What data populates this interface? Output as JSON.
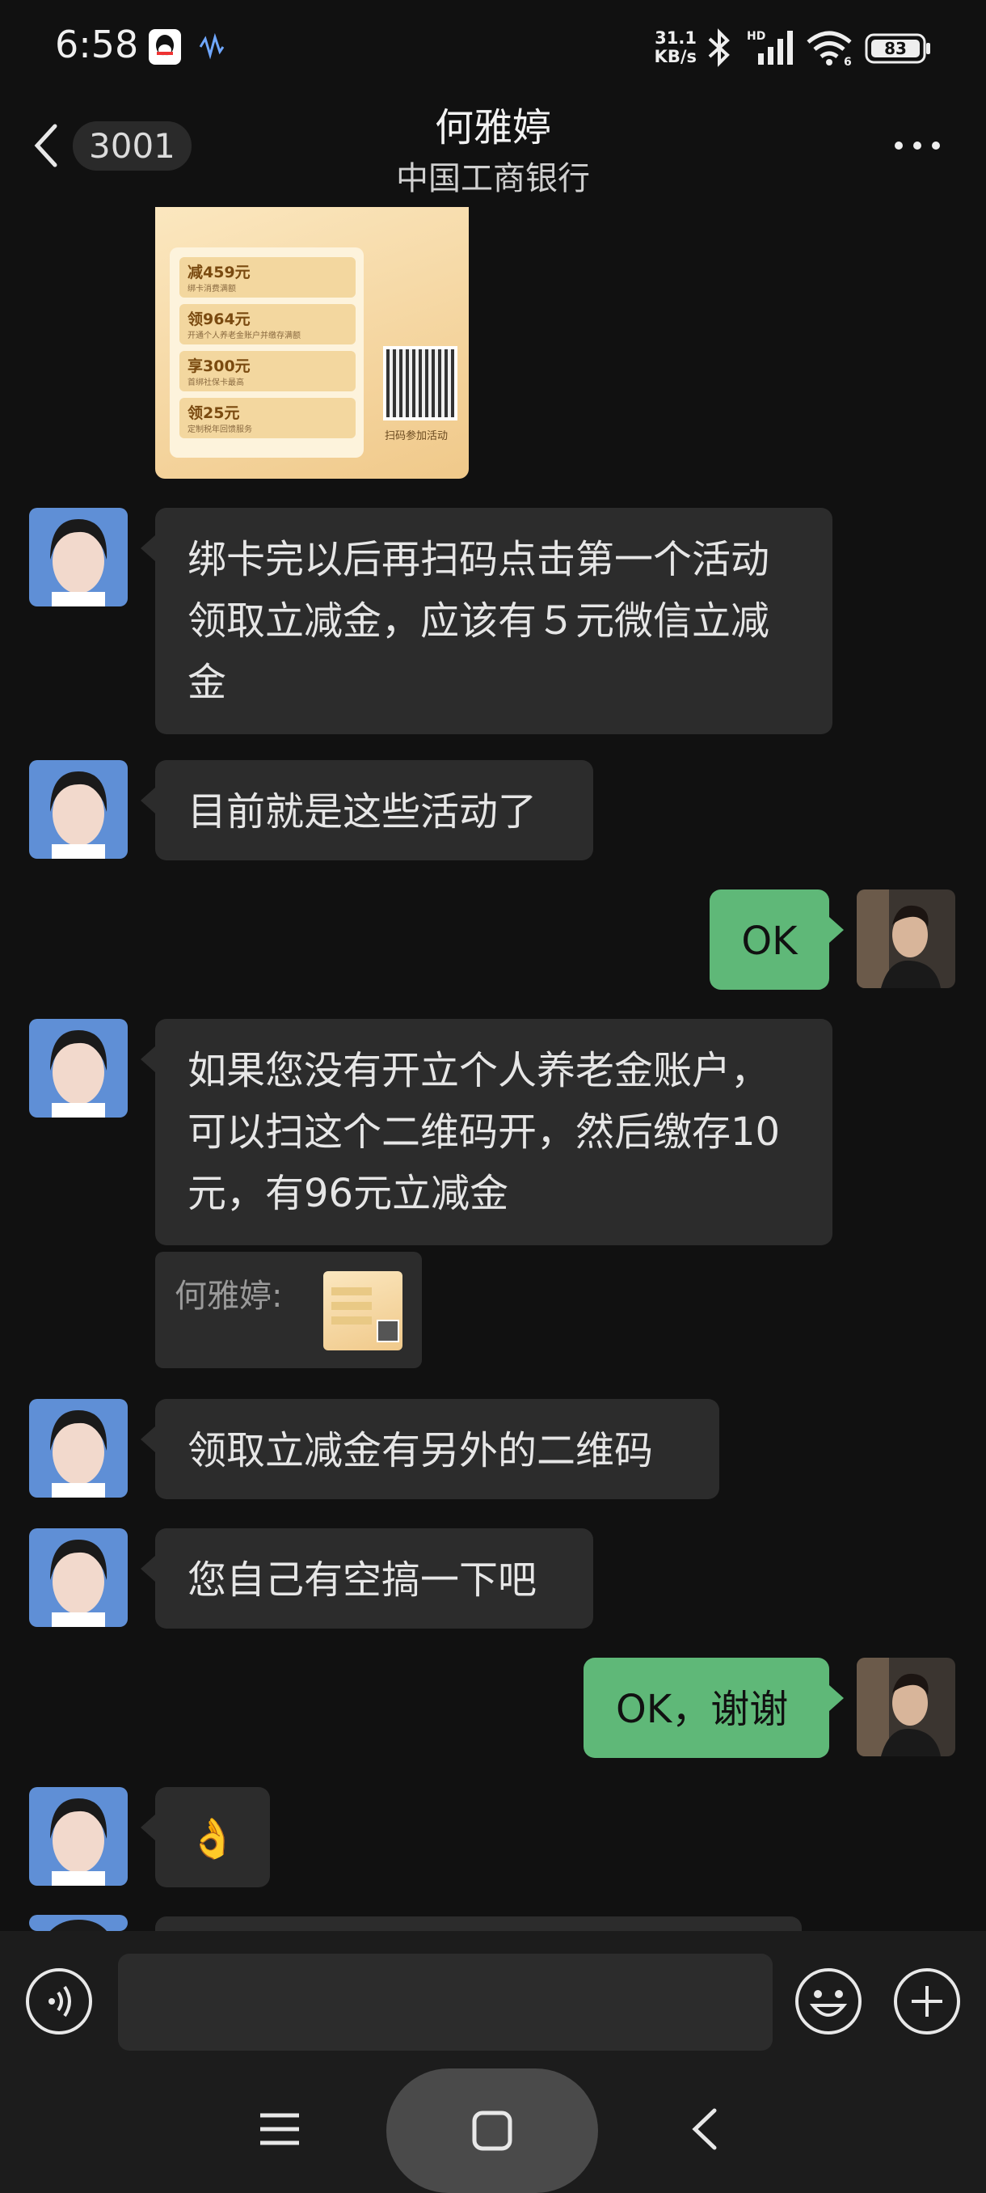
{
  "status_bar": {
    "time": "6:58",
    "net_speed_value": "31.1",
    "net_speed_unit": "KB/s",
    "signal_label": "HD",
    "wifi_label": "6",
    "battery": "83"
  },
  "header": {
    "unread_count": "3001",
    "title": "何雅婷",
    "subtitle": "中国工商银行"
  },
  "poster": {
    "rows": [
      {
        "amount": "减459元",
        "desc": "绑卡消费满额"
      },
      {
        "amount": "领964元",
        "desc": "开通个人养老金账户并缴存满额"
      },
      {
        "amount": "享300元",
        "desc": "首绑社保卡最高"
      },
      {
        "amount": "领25元",
        "desc": "定制税年回馈服务"
      }
    ],
    "qr_caption": "扫码参加活动"
  },
  "messages": [
    {
      "sender": "other",
      "text": "绑卡完以后再扫码点击第一个活动领取立减金，应该有５元微信立减金"
    },
    {
      "sender": "other",
      "text": "目前就是这些活动了"
    },
    {
      "sender": "me",
      "text": "OK"
    },
    {
      "sender": "other",
      "text": "如果您没有开立个人养老金账户，可以扫这个二维码开，然后缴存10元，有96元立减金"
    },
    {
      "sender": "other",
      "quote_name": "何雅婷:"
    },
    {
      "sender": "other",
      "text": "领取立减金有另外的二维码"
    },
    {
      "sender": "other",
      "text": "您自己有空搞一下吧"
    },
    {
      "sender": "me",
      "text": "OK，谢谢"
    },
    {
      "sender": "other",
      "text": "👌"
    }
  ],
  "input": {
    "placeholder": ""
  },
  "colors": {
    "background": "#111111",
    "bubble_other": "#2c2c2c",
    "bubble_me": "#5fb878"
  }
}
